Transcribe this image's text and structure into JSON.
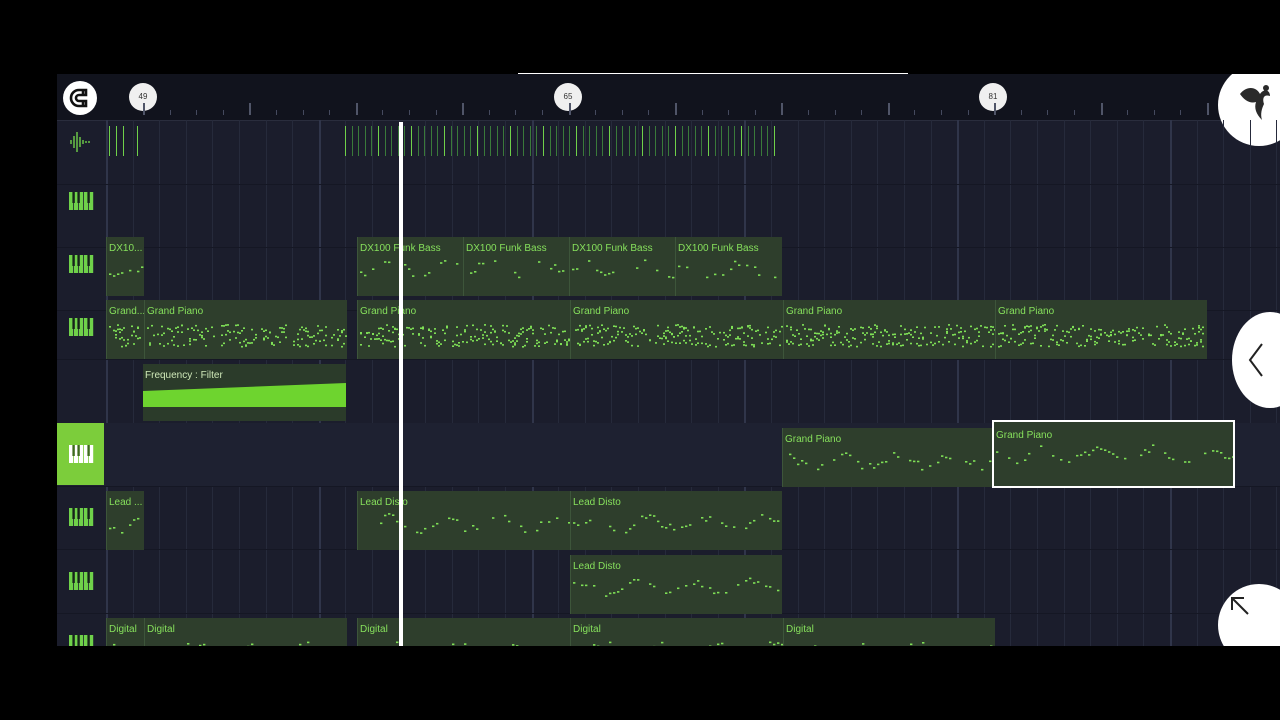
{
  "ruler": {
    "markers": [
      {
        "label": "49"
      },
      {
        "label": "65"
      },
      {
        "label": "81"
      }
    ]
  },
  "icons": {
    "snap": "magnet-icon",
    "logo": "fl-fruit-logo-icon",
    "side": "chevron-left-icon",
    "corner": "expand-arrow-icon",
    "track": "piano-keys-icon",
    "audio": "waveform-icon"
  },
  "colors": {
    "accent": "#7ccd3b",
    "clip_bg": "#2e3e2c",
    "clip_text": "#86e05c",
    "background": "#1b1d2c"
  },
  "clips": {
    "dx1": "DX10...",
    "dx2": "DX100 Funk Bass",
    "dx3": "DX100 Funk Bass",
    "dx4": "DX100 Funk Bass",
    "dx5": "DX100 Funk Bass",
    "gp1": "Grand...",
    "gp2": "Grand Piano",
    "gp3": "Grand Piano",
    "gp4": "Grand Piano",
    "gp5": "Grand Piano",
    "gp6": "Grand Piano",
    "auto": "Frequency : Filter",
    "gpb1": "Grand Piano",
    "gpb2": "Grand Piano",
    "ld1": "Lead ...",
    "ld2": "Lead Disto",
    "ld3": "Lead Disto",
    "ld4": "Lead Disto",
    "dg1": "Digital",
    "dg2": "Digital",
    "dg3": "Digital",
    "dg4": "Digital",
    "dg5": "Digital"
  }
}
